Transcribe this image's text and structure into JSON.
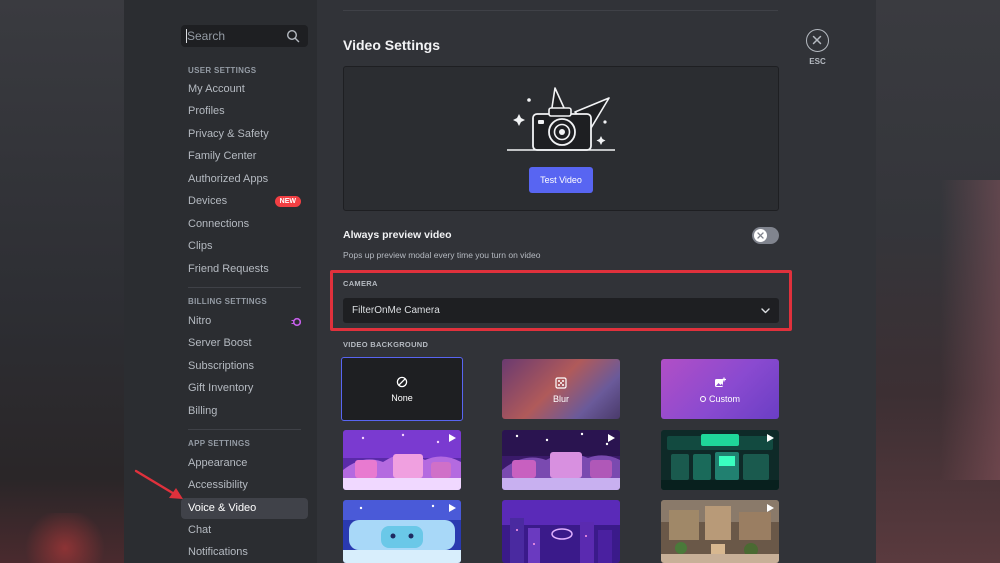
{
  "search": {
    "placeholder": "Search"
  },
  "sidebar": {
    "sections": [
      {
        "title": "USER SETTINGS"
      },
      {
        "title": "BILLING SETTINGS"
      },
      {
        "title": "APP SETTINGS"
      }
    ],
    "user_items": [
      {
        "label": "My Account"
      },
      {
        "label": "Profiles"
      },
      {
        "label": "Privacy & Safety"
      },
      {
        "label": "Family Center"
      },
      {
        "label": "Authorized Apps"
      },
      {
        "label": "Devices",
        "badge": "NEW"
      },
      {
        "label": "Connections"
      },
      {
        "label": "Clips"
      },
      {
        "label": "Friend Requests"
      }
    ],
    "billing_items": [
      {
        "label": "Nitro"
      },
      {
        "label": "Server Boost"
      },
      {
        "label": "Subscriptions"
      },
      {
        "label": "Gift Inventory"
      },
      {
        "label": "Billing"
      }
    ],
    "app_items": [
      {
        "label": "Appearance"
      },
      {
        "label": "Accessibility"
      },
      {
        "label": "Voice & Video",
        "active": true
      },
      {
        "label": "Chat"
      },
      {
        "label": "Notifications"
      }
    ]
  },
  "main": {
    "title": "Video Settings",
    "close_label": "ESC",
    "test_video_button": "Test Video",
    "always_preview": {
      "label": "Always preview video",
      "description": "Pops up preview modal every time you turn on video",
      "enabled": false
    },
    "camera": {
      "title": "CAMERA",
      "selected": "FilterOnMe Camera"
    },
    "video_background": {
      "title": "VIDEO BACKGROUND",
      "options": [
        {
          "label": "None",
          "icon": "none-icon",
          "selected": true
        },
        {
          "label": "Blur",
          "icon": "blur-icon"
        },
        {
          "label": "Custom",
          "icon": "add-image-icon"
        }
      ],
      "presets": [
        "animated-background",
        "animated-background",
        "animated-background",
        "animated-background",
        "animated-background",
        "animated-background"
      ]
    }
  },
  "colors": {
    "accent": "#5865f2",
    "highlight_red": "#e0313c",
    "badge_red": "#f23f43"
  }
}
